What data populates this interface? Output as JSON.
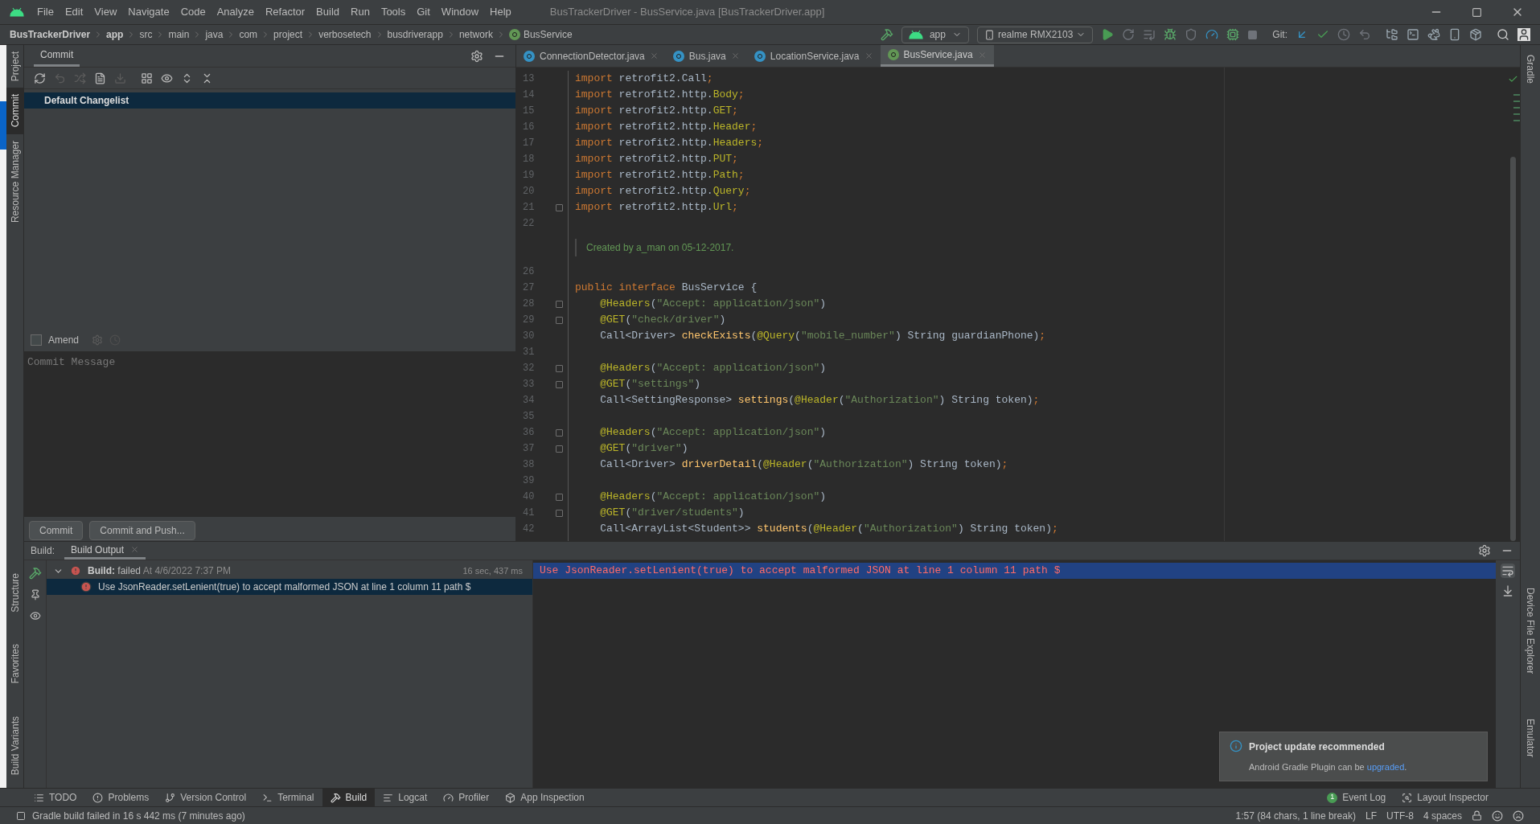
{
  "menu": [
    "File",
    "Edit",
    "View",
    "Navigate",
    "Code",
    "Analyze",
    "Refactor",
    "Build",
    "Run",
    "Tools",
    "Git",
    "Window",
    "Help"
  ],
  "window_title": "BusTrackerDriver - BusService.java [BusTrackerDriver.app]",
  "breadcrumb": [
    {
      "label": "BusTrackerDriver",
      "bold": true
    },
    {
      "label": "app",
      "bold": true
    },
    {
      "label": "src",
      "bold": false
    },
    {
      "label": "main",
      "bold": false
    },
    {
      "label": "java",
      "bold": false
    },
    {
      "label": "com",
      "bold": false
    },
    {
      "label": "project",
      "bold": false
    },
    {
      "label": "verbosetech",
      "bold": false
    },
    {
      "label": "busdriverapp",
      "bold": false
    },
    {
      "label": "network",
      "bold": false
    },
    {
      "label": "BusService",
      "bold": false,
      "kind": "interface"
    }
  ],
  "run_config": "app",
  "device": "realme RMX2103",
  "git_label": "Git:",
  "left_stripe": [
    {
      "label": "Project",
      "selected": false
    },
    {
      "label": "Commit",
      "selected": true
    },
    {
      "label": "Resource Manager",
      "selected": false
    }
  ],
  "left_stripe_bottom": [
    {
      "label": "Structure"
    },
    {
      "label": "Favorites"
    },
    {
      "label": "Build Variants"
    }
  ],
  "commit_panel": {
    "title": "Commit",
    "changelist": "Default Changelist",
    "amend": {
      "label": "Amend",
      "checked": false
    },
    "message_placeholder": "Commit Message",
    "buttons": [
      "Commit",
      "Commit and Push..."
    ]
  },
  "editor": {
    "tabs": [
      {
        "label": "ConnectionDetector.java",
        "kind": "class",
        "selected": false
      },
      {
        "label": "Bus.java",
        "kind": "class",
        "selected": false
      },
      {
        "label": "LocationService.java",
        "kind": "class",
        "selected": false
      },
      {
        "label": "BusService.java",
        "kind": "interface",
        "selected": true
      }
    ],
    "lines": [
      {
        "number": "13",
        "fold": false,
        "tokens": [
          {
            "kind": "kw",
            "text": "import"
          },
          {
            "kind": "plain",
            "text": " retrofit2.Call"
          },
          {
            "kind": "kw",
            "text": ";"
          }
        ]
      },
      {
        "number": "14",
        "fold": false,
        "tokens": [
          {
            "kind": "kw",
            "text": "import"
          },
          {
            "kind": "plain",
            "text": " retrofit2.http."
          },
          {
            "kind": "ann",
            "text": "Body"
          },
          {
            "kind": "kw",
            "text": ";"
          }
        ]
      },
      {
        "number": "15",
        "fold": false,
        "tokens": [
          {
            "kind": "kw",
            "text": "import"
          },
          {
            "kind": "plain",
            "text": " retrofit2.http."
          },
          {
            "kind": "ann",
            "text": "GET"
          },
          {
            "kind": "kw",
            "text": ";"
          }
        ]
      },
      {
        "number": "16",
        "fold": false,
        "tokens": [
          {
            "kind": "kw",
            "text": "import"
          },
          {
            "kind": "plain",
            "text": " retrofit2.http."
          },
          {
            "kind": "ann",
            "text": "Header"
          },
          {
            "kind": "kw",
            "text": ";"
          }
        ]
      },
      {
        "number": "17",
        "fold": false,
        "tokens": [
          {
            "kind": "kw",
            "text": "import"
          },
          {
            "kind": "plain",
            "text": " retrofit2.http."
          },
          {
            "kind": "ann",
            "text": "Headers"
          },
          {
            "kind": "kw",
            "text": ";"
          }
        ]
      },
      {
        "number": "18",
        "fold": false,
        "tokens": [
          {
            "kind": "kw",
            "text": "import"
          },
          {
            "kind": "plain",
            "text": " retrofit2.http."
          },
          {
            "kind": "ann",
            "text": "PUT"
          },
          {
            "kind": "kw",
            "text": ";"
          }
        ]
      },
      {
        "number": "19",
        "fold": false,
        "tokens": [
          {
            "kind": "kw",
            "text": "import"
          },
          {
            "kind": "plain",
            "text": " retrofit2.http."
          },
          {
            "kind": "ann",
            "text": "Path"
          },
          {
            "kind": "kw",
            "text": ";"
          }
        ]
      },
      {
        "number": "20",
        "fold": false,
        "tokens": [
          {
            "kind": "kw",
            "text": "import"
          },
          {
            "kind": "plain",
            "text": " retrofit2.http."
          },
          {
            "kind": "ann",
            "text": "Query"
          },
          {
            "kind": "kw",
            "text": ";"
          }
        ]
      },
      {
        "number": "21",
        "fold": true,
        "tokens": [
          {
            "kind": "kw",
            "text": "import"
          },
          {
            "kind": "plain",
            "text": " retrofit2.http."
          },
          {
            "kind": "ann",
            "text": "Url"
          },
          {
            "kind": "kw",
            "text": ";"
          }
        ]
      },
      {
        "number": "22",
        "fold": false
      },
      {
        "kind": "doc",
        "text": "Created by a_man on 05-12-2017."
      },
      {
        "number": "26",
        "fold": false
      },
      {
        "number": "27",
        "fold": false,
        "tokens": [
          {
            "kind": "kw",
            "text": "public interface"
          },
          {
            "kind": "plain",
            "text": " BusService {"
          }
        ]
      },
      {
        "number": "28",
        "fold": true,
        "tokens": [
          {
            "kind": "ann",
            "text": "    @Headers"
          },
          {
            "kind": "plain",
            "text": "("
          },
          {
            "kind": "str",
            "text": "\"Accept: application/json\""
          },
          {
            "kind": "plain",
            "text": ")"
          }
        ]
      },
      {
        "number": "29",
        "fold": true,
        "tokens": [
          {
            "kind": "ann",
            "text": "    @GET"
          },
          {
            "kind": "plain",
            "text": "("
          },
          {
            "kind": "str",
            "text": "\"check/driver\""
          },
          {
            "kind": "plain",
            "text": ")"
          }
        ]
      },
      {
        "number": "30",
        "fold": false,
        "tokens": [
          {
            "kind": "plain",
            "text": "    Call<Driver> "
          },
          {
            "kind": "method",
            "text": "checkExists"
          },
          {
            "kind": "plain",
            "text": "("
          },
          {
            "kind": "ann",
            "text": "@Query"
          },
          {
            "kind": "plain",
            "text": "("
          },
          {
            "kind": "str",
            "text": "\"mobile_number\""
          },
          {
            "kind": "plain",
            "text": ") String guardianPhone)"
          },
          {
            "kind": "kw",
            "text": ";"
          }
        ]
      },
      {
        "number": "31",
        "fold": false
      },
      {
        "number": "32",
        "fold": true,
        "tokens": [
          {
            "kind": "ann",
            "text": "    @Headers"
          },
          {
            "kind": "plain",
            "text": "("
          },
          {
            "kind": "str",
            "text": "\"Accept: application/json\""
          },
          {
            "kind": "plain",
            "text": ")"
          }
        ]
      },
      {
        "number": "33",
        "fold": true,
        "tokens": [
          {
            "kind": "ann",
            "text": "    @GET"
          },
          {
            "kind": "plain",
            "text": "("
          },
          {
            "kind": "str",
            "text": "\"settings\""
          },
          {
            "kind": "plain",
            "text": ")"
          }
        ]
      },
      {
        "number": "34",
        "fold": false,
        "tokens": [
          {
            "kind": "plain",
            "text": "    Call<SettingResponse> "
          },
          {
            "kind": "method",
            "text": "settings"
          },
          {
            "kind": "plain",
            "text": "("
          },
          {
            "kind": "ann",
            "text": "@Header"
          },
          {
            "kind": "plain",
            "text": "("
          },
          {
            "kind": "str",
            "text": "\"Authorization\""
          },
          {
            "kind": "plain",
            "text": ") String token)"
          },
          {
            "kind": "kw",
            "text": ";"
          }
        ]
      },
      {
        "number": "35",
        "fold": false
      },
      {
        "number": "36",
        "fold": true,
        "tokens": [
          {
            "kind": "ann",
            "text": "    @Headers"
          },
          {
            "kind": "plain",
            "text": "("
          },
          {
            "kind": "str",
            "text": "\"Accept: application/json\""
          },
          {
            "kind": "plain",
            "text": ")"
          }
        ]
      },
      {
        "number": "37",
        "fold": true,
        "tokens": [
          {
            "kind": "ann",
            "text": "    @GET"
          },
          {
            "kind": "plain",
            "text": "("
          },
          {
            "kind": "str",
            "text": "\"driver\""
          },
          {
            "kind": "plain",
            "text": ")"
          }
        ]
      },
      {
        "number": "38",
        "fold": false,
        "tokens": [
          {
            "kind": "plain",
            "text": "    Call<Driver> "
          },
          {
            "kind": "method",
            "text": "driverDetail"
          },
          {
            "kind": "plain",
            "text": "("
          },
          {
            "kind": "ann",
            "text": "@Header"
          },
          {
            "kind": "plain",
            "text": "("
          },
          {
            "kind": "str",
            "text": "\"Authorization\""
          },
          {
            "kind": "plain",
            "text": ") String token)"
          },
          {
            "kind": "kw",
            "text": ";"
          }
        ]
      },
      {
        "number": "39",
        "fold": false
      },
      {
        "number": "40",
        "fold": true,
        "tokens": [
          {
            "kind": "ann",
            "text": "    @Headers"
          },
          {
            "kind": "plain",
            "text": "("
          },
          {
            "kind": "str",
            "text": "\"Accept: application/json\""
          },
          {
            "kind": "plain",
            "text": ")"
          }
        ]
      },
      {
        "number": "41",
        "fold": true,
        "tokens": [
          {
            "kind": "ann",
            "text": "    @GET"
          },
          {
            "kind": "plain",
            "text": "("
          },
          {
            "kind": "str",
            "text": "\"driver/students\""
          },
          {
            "kind": "plain",
            "text": ")"
          }
        ]
      },
      {
        "number": "42",
        "fold": false,
        "tokens": [
          {
            "kind": "plain",
            "text": "    Call<ArrayList<Student>> "
          },
          {
            "kind": "method",
            "text": "students"
          },
          {
            "kind": "plain",
            "text": "("
          },
          {
            "kind": "ann",
            "text": "@Header"
          },
          {
            "kind": "plain",
            "text": "("
          },
          {
            "kind": "str",
            "text": "\"Authorization\""
          },
          {
            "kind": "plain",
            "text": ") String token)"
          },
          {
            "kind": "kw",
            "text": ";"
          }
        ]
      }
    ]
  },
  "build": {
    "label": "Build:",
    "tab": "Build Output",
    "tree": [
      {
        "title": "Build:",
        "status": "failed",
        "time": "At 4/6/2022 7:37 PM",
        "duration": "16 sec, 437 ms",
        "expanded": true,
        "selected": false,
        "children": [
          {
            "text": "Use JsonReader.setLenient(true) to accept malformed JSON at line 1 column 11 path $",
            "selected": true
          }
        ]
      }
    ],
    "console": "Use JsonReader.setLenient(true) to accept malformed JSON at line 1 column 11 path $"
  },
  "notification": {
    "title": "Project update recommended",
    "text": "Android Gradle Plugin can be ",
    "link": "upgraded",
    "after": "."
  },
  "right_stripe": [
    {
      "label": "Gradle"
    },
    {
      "label": "Device File Explorer"
    },
    {
      "label": "Emulator"
    }
  ],
  "tool_windows": [
    {
      "label": "TODO",
      "kind": "todo",
      "selected": false
    },
    {
      "label": "Problems",
      "kind": "problems",
      "selected": false
    },
    {
      "label": "Version Control",
      "kind": "vcs",
      "selected": false
    },
    {
      "label": "Terminal",
      "kind": "terminal",
      "selected": false
    },
    {
      "label": "Build",
      "kind": "build",
      "selected": true
    },
    {
      "label": "Logcat",
      "kind": "logcat",
      "selected": false
    },
    {
      "label": "Profiler",
      "kind": "profiler",
      "selected": false
    },
    {
      "label": "App Inspection",
      "kind": "inspection",
      "selected": false
    }
  ],
  "tool_windows_right": [
    {
      "label": "Event Log",
      "badge": "1"
    },
    {
      "label": "Layout Inspector"
    }
  ],
  "status": {
    "message": "Gradle build failed in 16 s 442 ms (7 minutes ago)",
    "position": "1:57 (84 chars, 1 line break)",
    "line_separator": "LF",
    "encoding": "UTF-8",
    "indent": "4 spaces"
  }
}
